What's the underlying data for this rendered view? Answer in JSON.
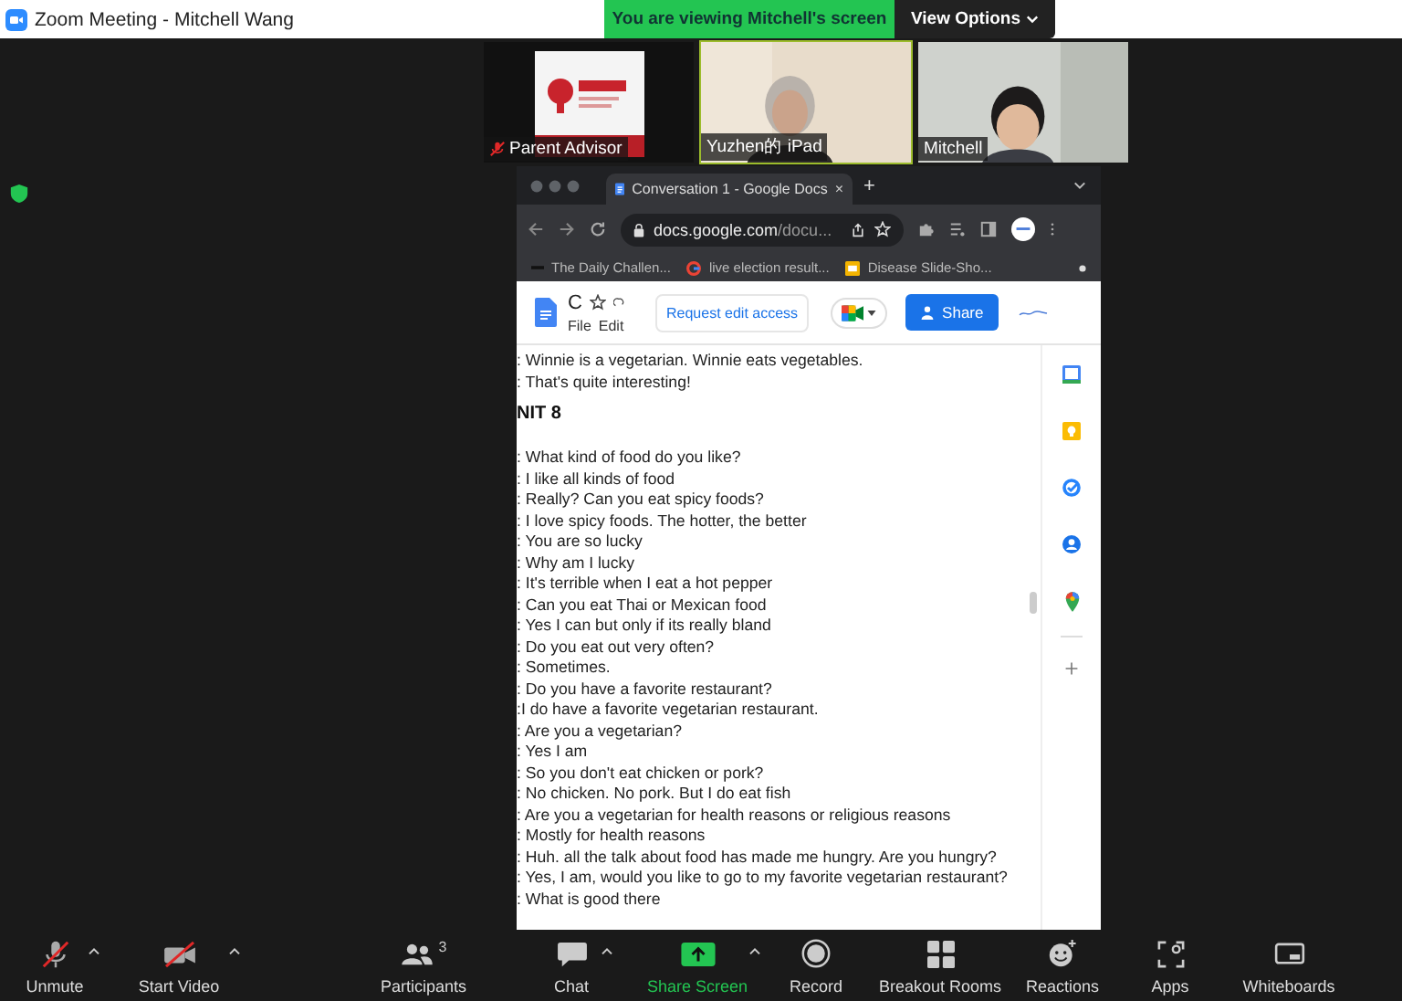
{
  "window": {
    "title": "Zoom Meeting - Mitchell Wang"
  },
  "banner": {
    "text": "You are viewing Mitchell's screen",
    "options": "View Options"
  },
  "participants_strip": [
    {
      "name": "Parent Advisor",
      "muted": true,
      "speaking": false,
      "kind": "poster"
    },
    {
      "name": "Yuzhen的 iPad",
      "muted": false,
      "speaking": true,
      "kind": "person-elder"
    },
    {
      "name": "Mitchell",
      "muted": false,
      "speaking": false,
      "kind": "person-boy"
    }
  ],
  "browser": {
    "tab": {
      "title": "Conversation 1 - Google Docs",
      "close": "×"
    },
    "new_tab": "+",
    "url": {
      "host": "docs.google.com",
      "path": "/docu..."
    },
    "bookmarks": [
      {
        "label": "The Daily Challen...",
        "kind": "dark"
      },
      {
        "label": "live election result...",
        "kind": "google"
      },
      {
        "label": "Disease Slide-Sho...",
        "kind": "slides"
      }
    ]
  },
  "doc": {
    "title": "C",
    "menus": [
      "File",
      "Edit"
    ],
    "request_button": "Request edit access",
    "share_button": "Share",
    "lines": [
      {
        "kind": "line",
        "text": ": Winnie is a vegetarian. Winnie eats vegetables."
      },
      {
        "kind": "line",
        "text": ": That's quite interesting!"
      },
      {
        "kind": "heading",
        "text": "NIT 8"
      },
      {
        "kind": "line",
        "text": ": What kind of food do you like?"
      },
      {
        "kind": "line",
        "text": ": I like all kinds of food"
      },
      {
        "kind": "line",
        "text": ": Really? Can you eat spicy foods?"
      },
      {
        "kind": "line",
        "text": ": I love spicy foods. The hotter, the better"
      },
      {
        "kind": "line",
        "text": ": You are so lucky"
      },
      {
        "kind": "line",
        "text": ": Why am I lucky"
      },
      {
        "kind": "line",
        "text": ": It's terrible when I eat a hot pepper"
      },
      {
        "kind": "line",
        "text": ": Can you eat Thai or Mexican food"
      },
      {
        "kind": "line",
        "text": ": Yes I can but only if its really bland"
      },
      {
        "kind": "line",
        "text": ": Do you eat out very often?"
      },
      {
        "kind": "line",
        "text": ": Sometimes."
      },
      {
        "kind": "line",
        "text": ": Do you have a favorite restaurant?"
      },
      {
        "kind": "line",
        "text": ":I do have a favorite vegetarian restaurant."
      },
      {
        "kind": "line",
        "text": ": Are you a vegetarian?"
      },
      {
        "kind": "line",
        "text": ": Yes I am"
      },
      {
        "kind": "line",
        "text": ": So you don't eat chicken or pork?"
      },
      {
        "kind": "line",
        "text": ": No chicken. No pork. But I do eat fish"
      },
      {
        "kind": "line",
        "text": ": Are you a vegetarian for health reasons or religious reasons"
      },
      {
        "kind": "line",
        "text": ": Mostly for health reasons"
      },
      {
        "kind": "line",
        "text": ": Huh. all the talk about food has made me hungry. Are you hungry?"
      },
      {
        "kind": "line",
        "text": ": Yes, I am, would you like to go to my favorite vegetarian restaurant?"
      },
      {
        "kind": "line",
        "text": ": What is good there"
      }
    ]
  },
  "toolbar": [
    {
      "label": "Unmute",
      "kind": "mic",
      "off": true,
      "caret": true
    },
    {
      "label": "Start Video",
      "kind": "video",
      "off": true,
      "caret": true
    },
    {
      "label": "Participants",
      "kind": "participants",
      "count": "3"
    },
    {
      "label": "Chat",
      "kind": "chat",
      "caret": true
    },
    {
      "label": "Share Screen",
      "kind": "share",
      "caret": true,
      "highlighted": true
    },
    {
      "label": "Record",
      "kind": "record"
    },
    {
      "label": "Breakout Rooms",
      "kind": "breakout"
    },
    {
      "label": "Reactions",
      "kind": "reactions"
    },
    {
      "label": "Apps",
      "kind": "apps"
    },
    {
      "label": "Whiteboards",
      "kind": "whiteboard"
    }
  ]
}
